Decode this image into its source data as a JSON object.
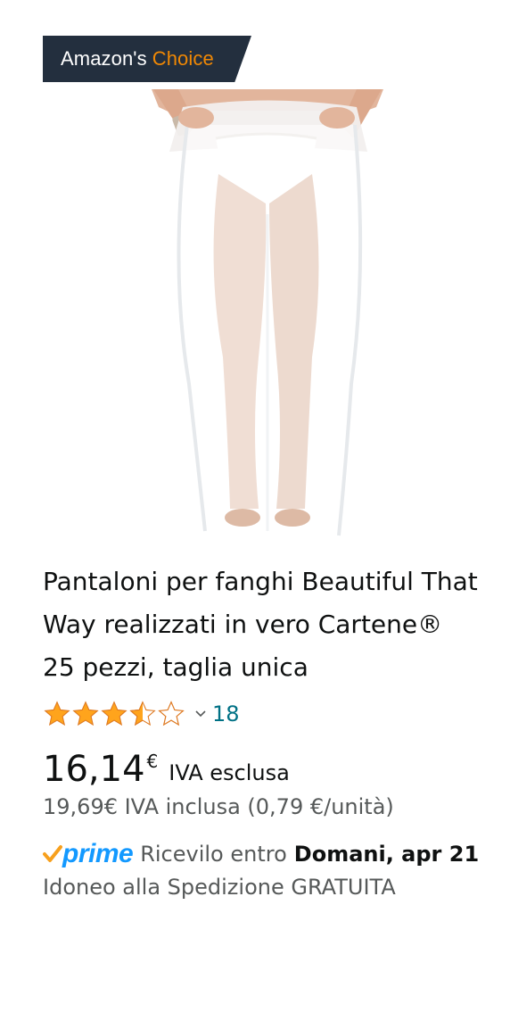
{
  "badge": {
    "prefix": "Amazon's",
    "highlight": "Choice"
  },
  "product": {
    "title": "Pantaloni per fanghi Beautiful That Way realizzati in vero Cartene® 25 pezzi, taglia unica",
    "image_icon": "product-photo",
    "rating": 3.5,
    "review_count": "18"
  },
  "price": {
    "main": "16,14",
    "currency": "€",
    "note": "IVA esclusa",
    "inclusive": "19,69€ IVA inclusa (0,79 €/unità)"
  },
  "delivery": {
    "prime_label": "prime",
    "lead": "Ricevilo entro",
    "date": "Domani, apr 21",
    "free_shipping": "Idoneo alla Spedizione GRATUITA"
  },
  "colors": {
    "badge_bg": "#232f3e",
    "choice_orange": "#f08804",
    "star": "#ffa41c",
    "link": "#007185",
    "prime_blue": "#1399ff",
    "prime_check": "#f7a01d"
  }
}
